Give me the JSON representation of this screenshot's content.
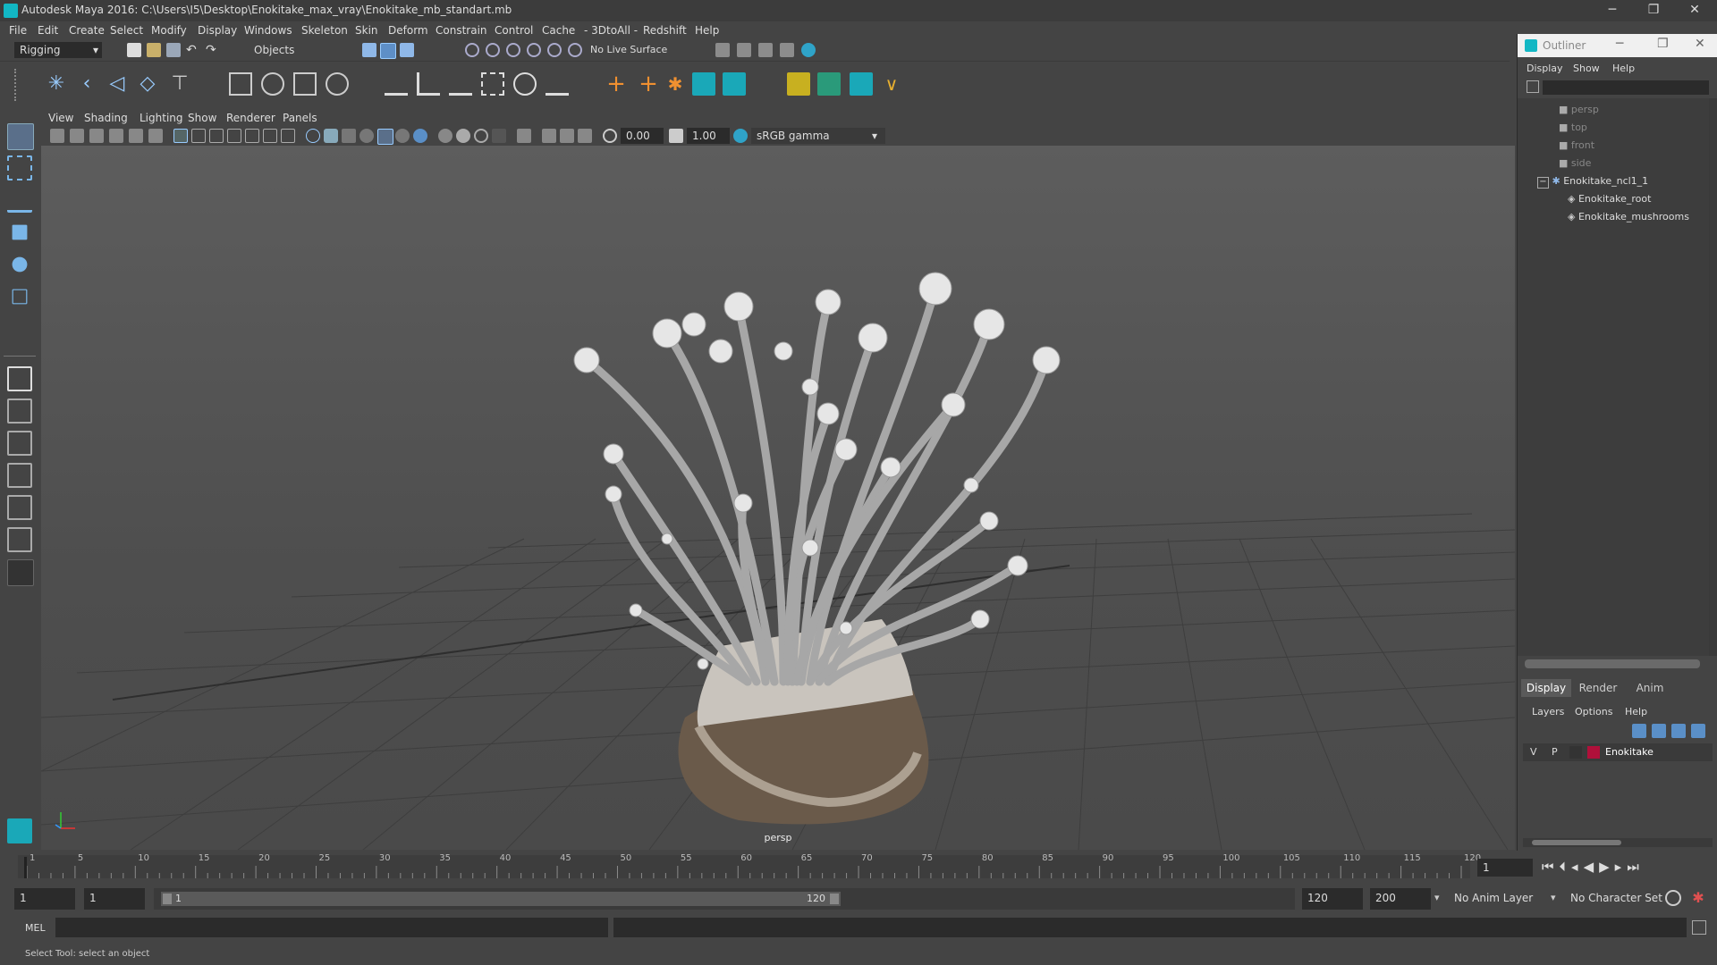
{
  "window": {
    "title": "Autodesk Maya 2016: C:\\Users\\I5\\Desktop\\Enokitake_max_vray\\Enokitake_mb_standart.mb",
    "minimize": "─",
    "restore": "❐",
    "close": "✕"
  },
  "menubar": [
    "File",
    "Edit",
    "Create",
    "Select",
    "Modify",
    "Display",
    "Windows",
    "Skeleton",
    "Skin",
    "Deform",
    "Constrain",
    "Control",
    "Cache",
    "- 3DtoAll -",
    "Redshift",
    "Help"
  ],
  "statusline": {
    "menuset": "Rigging",
    "selection_mode": "Objects",
    "live_surface": "No Live Surface"
  },
  "panel": {
    "menus": [
      "View",
      "Shading",
      "Lighting",
      "Show",
      "Renderer",
      "Panels"
    ],
    "exposure": "0.00",
    "gamma": "1.00",
    "color_space": "sRGB gamma",
    "camera_label": "persp"
  },
  "outliner": {
    "title": "Outliner",
    "menus": [
      "Display",
      "Show",
      "Help"
    ],
    "items": [
      {
        "label": "persp",
        "dim": true,
        "indent": 0
      },
      {
        "label": "top",
        "dim": true,
        "indent": 0
      },
      {
        "label": "front",
        "dim": true,
        "indent": 0
      },
      {
        "label": "side",
        "dim": true,
        "indent": 0
      },
      {
        "label": "Enokitake_ncl1_1",
        "dim": false,
        "indent": 0
      },
      {
        "label": "Enokitake_root",
        "dim": false,
        "indent": 1
      },
      {
        "label": "Enokitake_mushrooms",
        "dim": false,
        "indent": 1
      }
    ],
    "expand_symbol": "−"
  },
  "layers": {
    "tabs": [
      "Display",
      "Render",
      "Anim"
    ],
    "menus": [
      "Layers",
      "Options",
      "Help"
    ],
    "layer": {
      "v": "V",
      "p": "P",
      "name": "Enokitake",
      "color": "#b0103a"
    }
  },
  "timeline": {
    "ticks": [
      "1",
      "5",
      "10",
      "15",
      "20",
      "25",
      "30",
      "35",
      "40",
      "45",
      "50",
      "55",
      "60",
      "65",
      "70",
      "75",
      "80",
      "85",
      "90",
      "95",
      "100",
      "105",
      "110",
      "115",
      "120"
    ],
    "current_frame": "1"
  },
  "range": {
    "start": "1",
    "playback_start": "1",
    "slider_start": "1",
    "slider_end": "120",
    "playback_end": "120",
    "end": "200",
    "anim_layer": "No Anim Layer",
    "character_set": "No Character Set"
  },
  "cmdline": {
    "label": "MEL"
  },
  "helpline": {
    "text": "Select Tool: select an object"
  },
  "colors": {
    "accent": "#12b7c4",
    "panel": "#444444",
    "field": "#2b2b2b"
  }
}
